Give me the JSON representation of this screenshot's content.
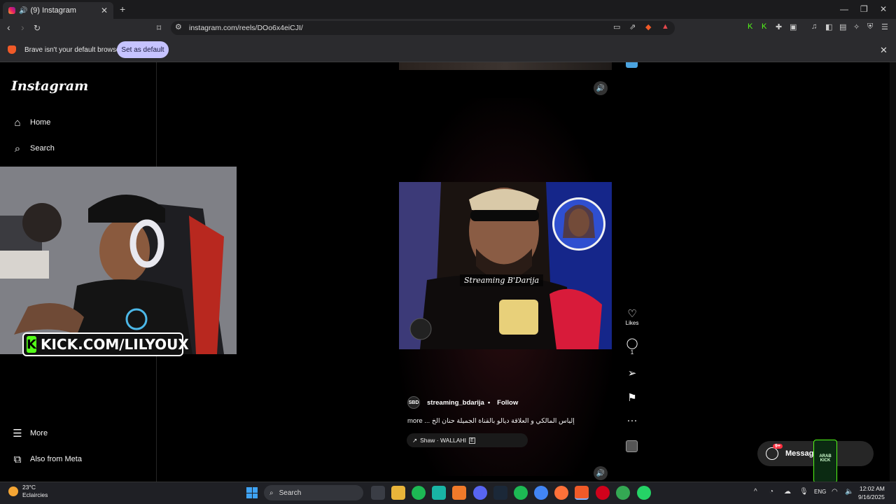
{
  "browser": {
    "tab_title": "(9) Instagram",
    "url": "instagram.com/reels/DOo6x4eiCJI/",
    "infobar_text": "Brave isn't your default browser",
    "set_default_label": "Set as default"
  },
  "sidebar": {
    "logo": "Instagram",
    "items": [
      {
        "label": "Home",
        "icon": "home-icon"
      },
      {
        "label": "Search",
        "icon": "search-icon"
      }
    ],
    "bottom_items": [
      {
        "label": "More",
        "icon": "menu-icon"
      },
      {
        "label": "Also from Meta",
        "icon": "meta-icon"
      }
    ]
  },
  "webcam": {
    "kick_url": "KICK.COM/LILYOUX"
  },
  "reel": {
    "overlay_text": "Streaming B'Darija",
    "author": "streaming_bdarija",
    "follow_label": "Follow",
    "caption": "more ... إلياس المالكي و العلاقة ديالو بالقناة الجميلة حنان الخ",
    "audio": "Shaw · WALLAHI",
    "likes_label": "Likes",
    "comments_count": "1"
  },
  "messages": {
    "label": "Message",
    "badge": "9+"
  },
  "taskbar": {
    "temperature": "23°C",
    "weather": "Eclaircies",
    "search_placeholder": "Search",
    "language": "ENG",
    "time": "12:02 AM",
    "date": "9/16/2025"
  },
  "colors": {
    "kick_green": "#53fc18",
    "set_default_bg": "#c6c3ff",
    "notification_red": "#ff3040"
  }
}
